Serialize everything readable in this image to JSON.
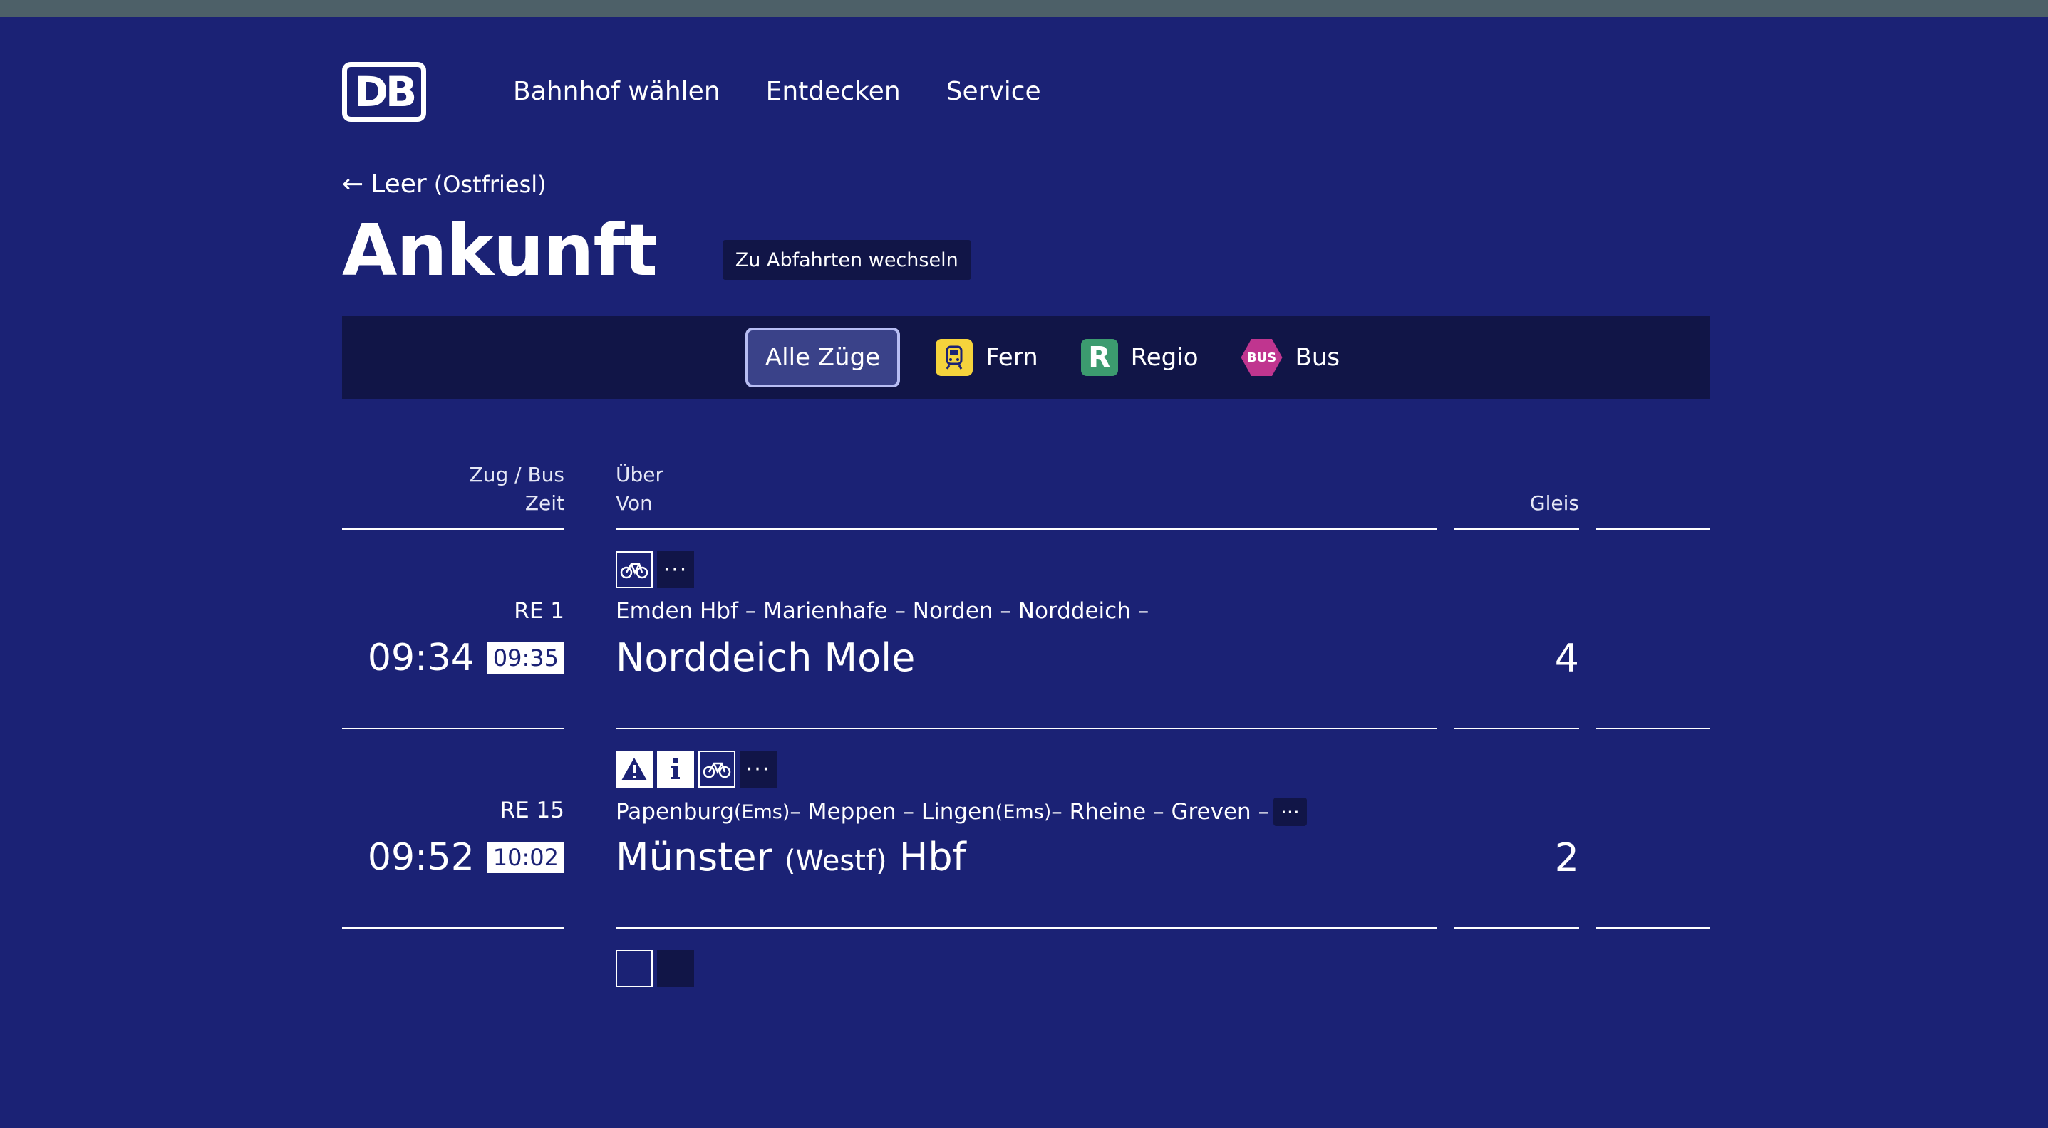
{
  "header": {
    "logo": "DB",
    "nav": [
      "Bahnhof wählen",
      "Entdecken",
      "Service"
    ]
  },
  "back": {
    "station": "Leer",
    "station_sub": "(Ostfriesl)"
  },
  "title": "Ankunft",
  "switch_button": "Zu Abfahrten wechseln",
  "filters": {
    "all": "Alle Züge",
    "fern": "Fern",
    "regio": "Regio",
    "regio_badge": "R",
    "bus": "Bus",
    "bus_badge": "BUS"
  },
  "columns": {
    "zug_bus": "Zug / Bus",
    "zeit": "Zeit",
    "ueber": "Über",
    "von": "Von",
    "gleis": "Gleis"
  },
  "rows": [
    {
      "line": "RE 1",
      "time": "09:34",
      "actual": "09:35",
      "via": "Emden Hbf – Marienhafe – Norden – Norddeich –",
      "destination": "Norddeich Mole",
      "platform": "4"
    },
    {
      "line": "RE 15",
      "time": "09:52",
      "actual": "10:02",
      "via_parts": [
        "Papenburg ",
        "(Ems)",
        " – Meppen – Lingen ",
        "(Ems)",
        " – Rheine – Greven –"
      ],
      "destination_main": "Münster ",
      "destination_sub": "(Westf)",
      "destination_end": " Hbf",
      "platform": "2"
    }
  ],
  "colors": {
    "background": "#1b2275",
    "dark_panel": "#111547",
    "fern": "#f5d33c",
    "regio": "#3c9b6f",
    "bus": "#c0358f"
  },
  "icons": [
    "bike-icon",
    "more-icon",
    "warning-icon",
    "info-icon",
    "arrow-left-icon",
    "train-icon"
  ]
}
